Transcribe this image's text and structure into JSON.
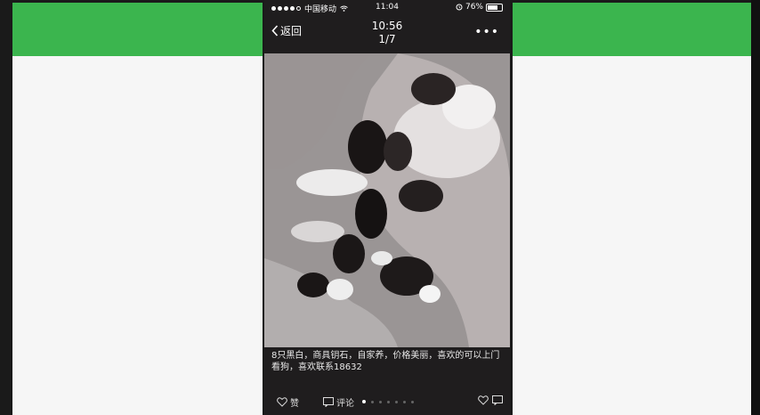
{
  "status_bar": {
    "carrier": "中国移动",
    "time": "11:04",
    "battery_text": "76%",
    "battery_level": 0.76
  },
  "nav": {
    "back_label": "返回",
    "title_time": "10:56",
    "title_index": "1/7",
    "more_label": "•••"
  },
  "caption": {
    "text": "8只黑白，商具钥石，自家养，价格美丽，喜欢的可以上门看狗，喜欢联系18632"
  },
  "actions": {
    "like_label": "赞",
    "comment_label": "评论"
  },
  "pager": {
    "total": 7,
    "current": 1
  },
  "colors": {
    "accent_green": "#3bb54e",
    "phone_bg": "#1f1d1e"
  }
}
